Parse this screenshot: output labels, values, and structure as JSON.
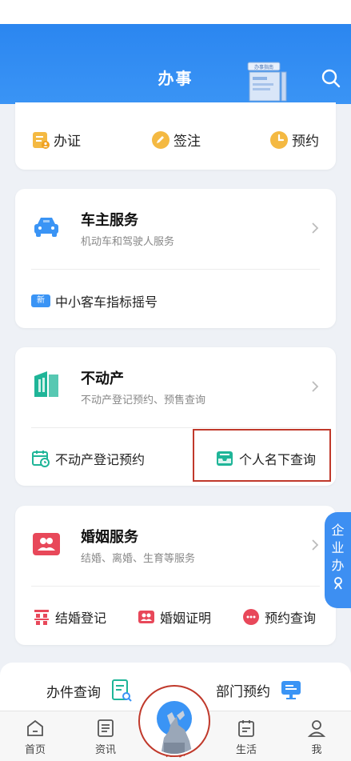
{
  "header": {
    "title": "办事",
    "guide_label": "办事指南"
  },
  "quick_row": {
    "items": [
      "办证",
      "签注",
      "预约"
    ]
  },
  "car_service": {
    "title": "车主服务",
    "subtitle": "机动车和驾驶人服务",
    "sub_item": "中小客车指标摇号",
    "badge": "新"
  },
  "real_estate": {
    "title": "不动产",
    "subtitle": "不动产登记预约、预售查询",
    "sub_items": [
      "不动产登记预约",
      "个人名下查询"
    ]
  },
  "marriage": {
    "title": "婚姻服务",
    "subtitle": "结婚、离婚、生育等服务",
    "sub_items": [
      "结婚登记",
      "婚姻证明",
      "预约查询"
    ]
  },
  "side_tab": {
    "chars": [
      "企",
      "业",
      "办"
    ]
  },
  "bottom_links": [
    "办件查询",
    "部门预约"
  ],
  "tabbar": {
    "items": [
      "首页",
      "资讯",
      "办事",
      "生活",
      "我"
    ],
    "active_index": 2
  },
  "colors": {
    "primary": "#3a94f5",
    "active_tab": "#c0392b"
  }
}
